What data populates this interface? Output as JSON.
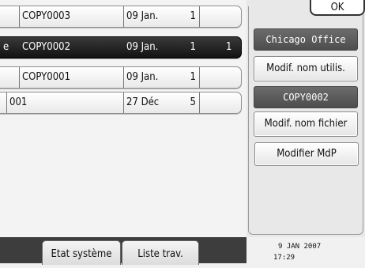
{
  "file_list": {
    "rows": [
      {
        "name": "COPY0003",
        "date": "09 Jan.",
        "pages": "1",
        "copies": "",
        "selected": false,
        "marker": ""
      },
      {
        "name": "COPY0002",
        "date": "09 Jan.",
        "pages": "1",
        "copies": "1",
        "selected": true,
        "marker": "e"
      },
      {
        "name": "COPY0001",
        "date": "09 Jan.",
        "pages": "1",
        "copies": "",
        "selected": false,
        "marker": ""
      },
      {
        "name": "001",
        "date": "27 Déc",
        "pages": "5",
        "copies": "",
        "selected": false,
        "marker": ""
      }
    ]
  },
  "side_panel": {
    "ok_label": "OK",
    "user_name": "Chicago Office",
    "change_user_label": "Modif. nom utilis.",
    "file_name": "COPY0002",
    "change_file_label": "Modif. nom fichier",
    "change_password_label": "Modifier MdP"
  },
  "bottom_bar": {
    "system_status_label": "Etat système",
    "job_list_label": "Liste trav.",
    "date": "9 JAN  2007",
    "time": "17:29"
  }
}
